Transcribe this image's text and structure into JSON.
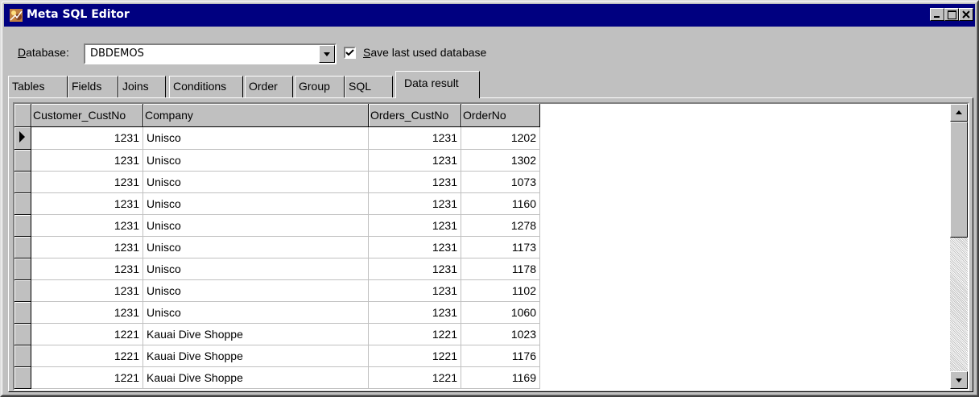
{
  "window": {
    "title": "Meta SQL Editor"
  },
  "database": {
    "label_underlined": "D",
    "label_rest": "atabase:",
    "value": "DBDEMOS"
  },
  "save_last": {
    "label_underlined": "S",
    "label_rest": "ave last used database",
    "checked": true
  },
  "tabs": [
    {
      "label": "Tables"
    },
    {
      "label": "Fields"
    },
    {
      "label": "Joins"
    },
    {
      "label": "Conditions"
    },
    {
      "label": "Order"
    },
    {
      "label": "Group"
    },
    {
      "label": "SQL"
    },
    {
      "label": "Data result",
      "active": true
    }
  ],
  "grid": {
    "columns": [
      "Customer_CustNo",
      "Company",
      "Orders_CustNo",
      "OrderNo"
    ],
    "rows": [
      [
        "1231",
        "Unisco",
        "1231",
        "1202"
      ],
      [
        "1231",
        "Unisco",
        "1231",
        "1302"
      ],
      [
        "1231",
        "Unisco",
        "1231",
        "1073"
      ],
      [
        "1231",
        "Unisco",
        "1231",
        "1160"
      ],
      [
        "1231",
        "Unisco",
        "1231",
        "1278"
      ],
      [
        "1231",
        "Unisco",
        "1231",
        "1173"
      ],
      [
        "1231",
        "Unisco",
        "1231",
        "1178"
      ],
      [
        "1231",
        "Unisco",
        "1231",
        "1102"
      ],
      [
        "1231",
        "Unisco",
        "1231",
        "1060"
      ],
      [
        "1221",
        "Kauai Dive Shoppe",
        "1221",
        "1023"
      ],
      [
        "1221",
        "Kauai Dive Shoppe",
        "1221",
        "1176"
      ],
      [
        "1221",
        "Kauai Dive Shoppe",
        "1221",
        "1169"
      ]
    ],
    "current_row": 0
  },
  "colors": {
    "titlebar": "#000080",
    "face": "#c0c0c0"
  }
}
